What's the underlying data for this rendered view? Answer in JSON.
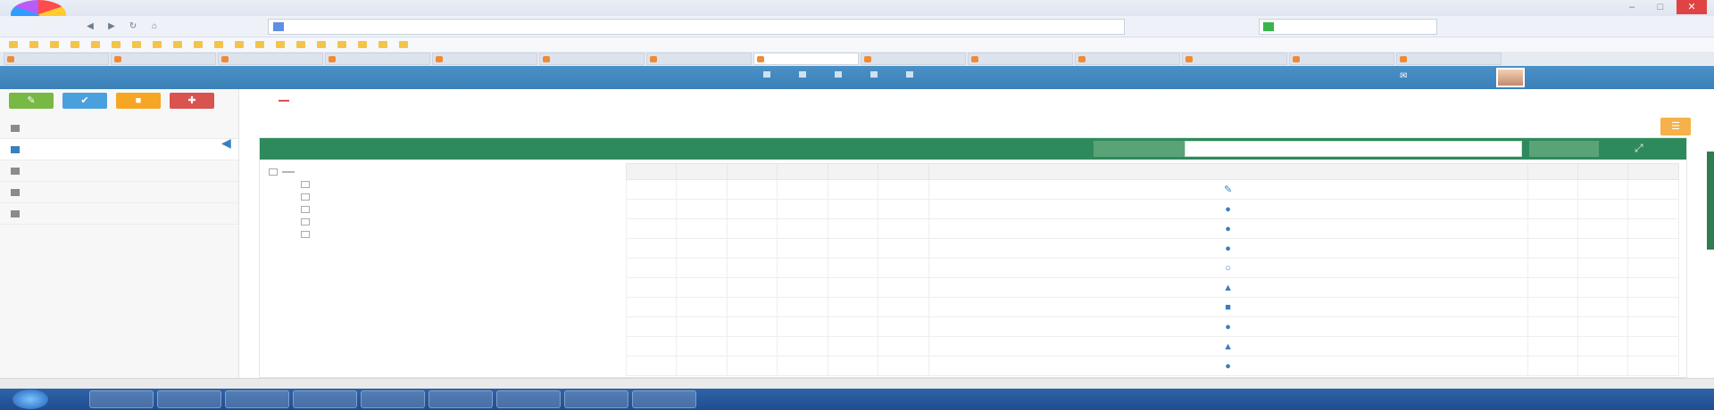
{
  "browser": {
    "title": "",
    "url": "",
    "search_box": "",
    "win_minimize": "–",
    "win_maximize": "□",
    "win_close": "✕",
    "nav_back": "◀",
    "nav_forward": "▶",
    "nav_refresh": "↻",
    "nav_home": "⌂"
  },
  "bookmarks": [
    "",
    "",
    "",
    "",
    "",
    "",
    "",
    "",
    "",
    "",
    "",
    "",
    "",
    "",
    "",
    "",
    "",
    "",
    "",
    ""
  ],
  "tabs": [
    "",
    "",
    "",
    "",
    "",
    "",
    "",
    "",
    "",
    "",
    "",
    "",
    "",
    ""
  ],
  "header": {
    "brand": "",
    "links": [
      "",
      "",
      "",
      "",
      ""
    ],
    "mail_count": "",
    "user_name": ""
  },
  "sidebar": {
    "quick_buttons": [
      "✎",
      "✔",
      "■",
      "✚"
    ],
    "items": [
      "",
      "",
      "",
      "",
      ""
    ],
    "collapse_icon": "◀"
  },
  "content": {
    "breadcrumb": "",
    "side_button": "☰"
  },
  "panel": {
    "title": "",
    "search_label": "",
    "search_value": "",
    "search_button": "",
    "expand_icon": "⤢"
  },
  "tree": {
    "root": "",
    "children": [
      "",
      "",
      "",
      "",
      ""
    ]
  },
  "grid": {
    "headers": [
      "",
      "",
      "",
      "",
      "",
      "",
      "",
      "",
      "",
      ""
    ],
    "rows": [
      [
        "",
        "",
        "",
        "",
        "",
        "",
        "✎",
        "",
        "",
        ""
      ],
      [
        "",
        "",
        "",
        "",
        "",
        "",
        "●",
        "",
        "",
        ""
      ],
      [
        "",
        "",
        "",
        "",
        "",
        "",
        "●",
        "",
        "",
        ""
      ],
      [
        "",
        "",
        "",
        "",
        "",
        "",
        "●",
        "",
        "",
        ""
      ],
      [
        "",
        "",
        "",
        "",
        "",
        "",
        "○",
        "",
        "",
        ""
      ],
      [
        "",
        "",
        "",
        "",
        "",
        "",
        "▲",
        "",
        "",
        ""
      ],
      [
        "",
        "",
        "",
        "",
        "",
        "",
        "■",
        "",
        "",
        ""
      ],
      [
        "",
        "",
        "",
        "",
        "",
        "",
        "●",
        "",
        "",
        ""
      ],
      [
        "",
        "",
        "",
        "",
        "",
        "",
        "▲",
        "",
        "",
        ""
      ],
      [
        "",
        "",
        "",
        "",
        "",
        "",
        "●",
        "",
        "",
        ""
      ]
    ]
  },
  "taskbar": {
    "clock": ""
  }
}
